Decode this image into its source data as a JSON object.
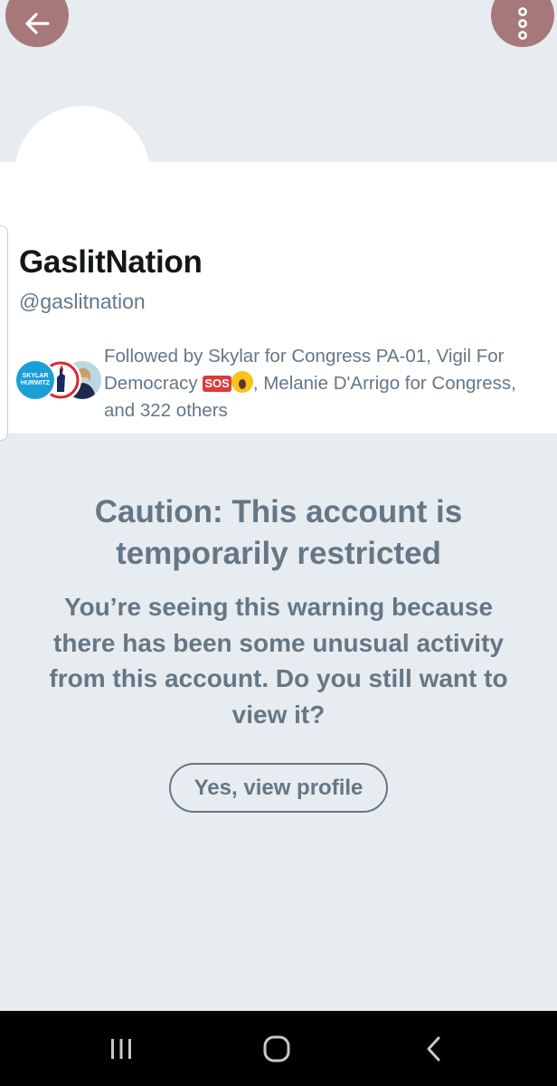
{
  "header": {
    "back_icon": "arrow-left-icon",
    "more_icon": "vertical-dots-icon",
    "button_color": "#a6787a"
  },
  "profile": {
    "display_name": "GaslitNation",
    "handle": "@gaslitnation",
    "followed_by": {
      "prefix": "Followed by Skylar for Congress PA-01, Vigil For Democracy ",
      "sos_badge": "SOS",
      "emoji": "scream-emoji",
      "suffix": ", Melanie D'Arrigo for Congress, and 322 others"
    },
    "follower_avatars": [
      {
        "name": "skylar-for-congress",
        "text_top": "SKYLAR",
        "text_bottom": "HURWITZ"
      },
      {
        "name": "vigil-for-democracy"
      },
      {
        "name": "melanie-darrigo"
      }
    ]
  },
  "warning": {
    "title": "Caution: This account is temporarily restricted",
    "body": "You’re seeing this warning because there has been some unusual activity from this account. Do you still want to view it?",
    "button_label": "Yes, view profile"
  },
  "system_nav": {
    "recents_icon": "recents-icon",
    "home_icon": "home-icon",
    "back_icon": "chevron-left-icon"
  },
  "colors": {
    "background": "#e6ecf0",
    "text_secondary": "#657786",
    "text_primary": "#14171a"
  }
}
